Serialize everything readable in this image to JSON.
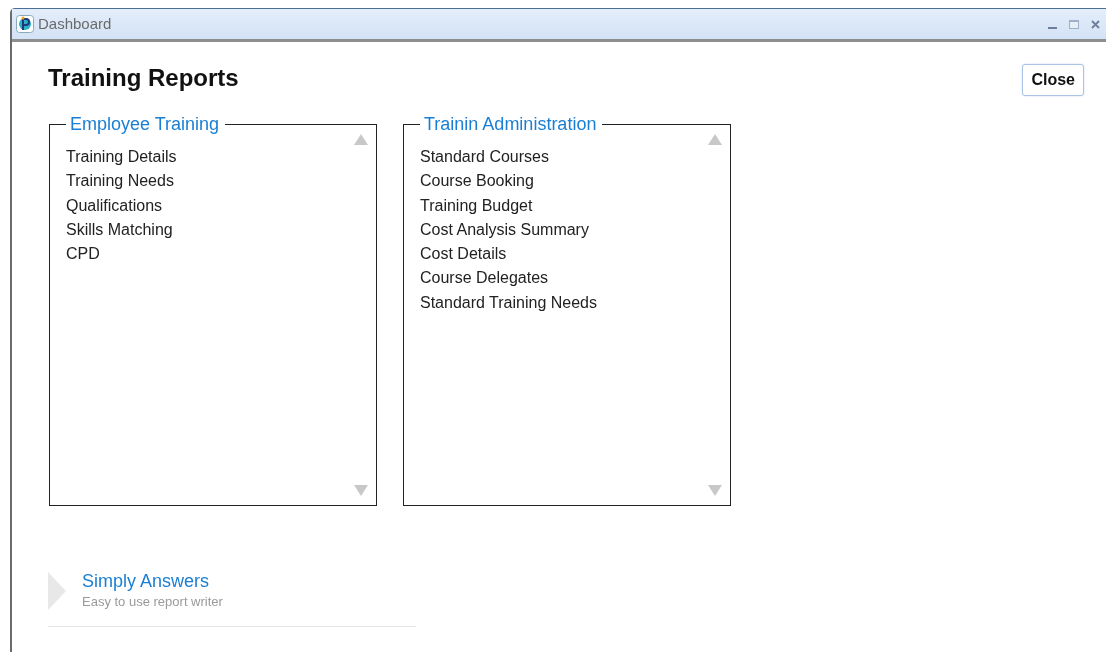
{
  "window": {
    "title": "Dashboard"
  },
  "page": {
    "title": "Training Reports",
    "close_button": "Close"
  },
  "panels": [
    {
      "title": "Employee Training",
      "items": [
        "Training Details",
        "Training Needs",
        "Qualifications",
        "Skills Matching",
        "CPD"
      ]
    },
    {
      "title": "Trainin Administration",
      "items": [
        "Standard Courses",
        "Course Booking",
        "Training Budget",
        "Cost Analysis Summary",
        "Cost Details",
        "Course Delegates",
        "Standard Training Needs"
      ]
    }
  ],
  "footer_link": {
    "title": "Simply Answers",
    "subtitle": "Easy to use report writer"
  }
}
